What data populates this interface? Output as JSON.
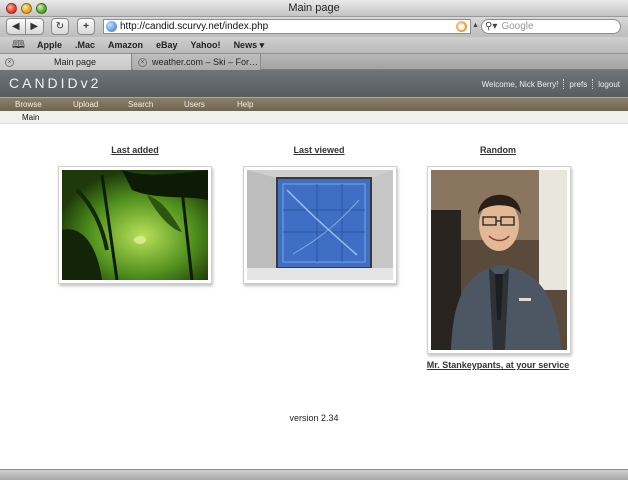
{
  "window": {
    "title": "Main page"
  },
  "toolbar": {
    "back_glyph": "◀",
    "forward_glyph": "▶",
    "reload_glyph": "↻",
    "add_glyph": "+",
    "url": "http://candid.scurvy.net/index.php",
    "search_placeholder": "Google"
  },
  "bookmarks": [
    "Apple",
    ".Mac",
    "Amazon",
    "eBay",
    "Yahoo!",
    "News ▾"
  ],
  "tabs": [
    {
      "label": "Main page",
      "active": true
    },
    {
      "label": "weather.com – Ski – For…",
      "active": false
    }
  ],
  "site": {
    "logo": "CANDIDv2",
    "welcome": "Welcome, Nick Berry!",
    "prefs": "prefs",
    "logout": "logout",
    "nav": [
      "Browse",
      "Upload",
      "Search",
      "Users",
      "Help"
    ],
    "breadcrumb": "Main"
  },
  "sections": {
    "last_added": {
      "title": "Last added"
    },
    "last_viewed": {
      "title": "Last viewed"
    },
    "random": {
      "title": "Random",
      "caption": "Mr. Stankeypants, at your service"
    }
  },
  "footer": {
    "version": "version 2.34"
  },
  "colors": {
    "header_bg": "#5f6569",
    "nav_bg": "#7d725d",
    "link": "#333333"
  }
}
